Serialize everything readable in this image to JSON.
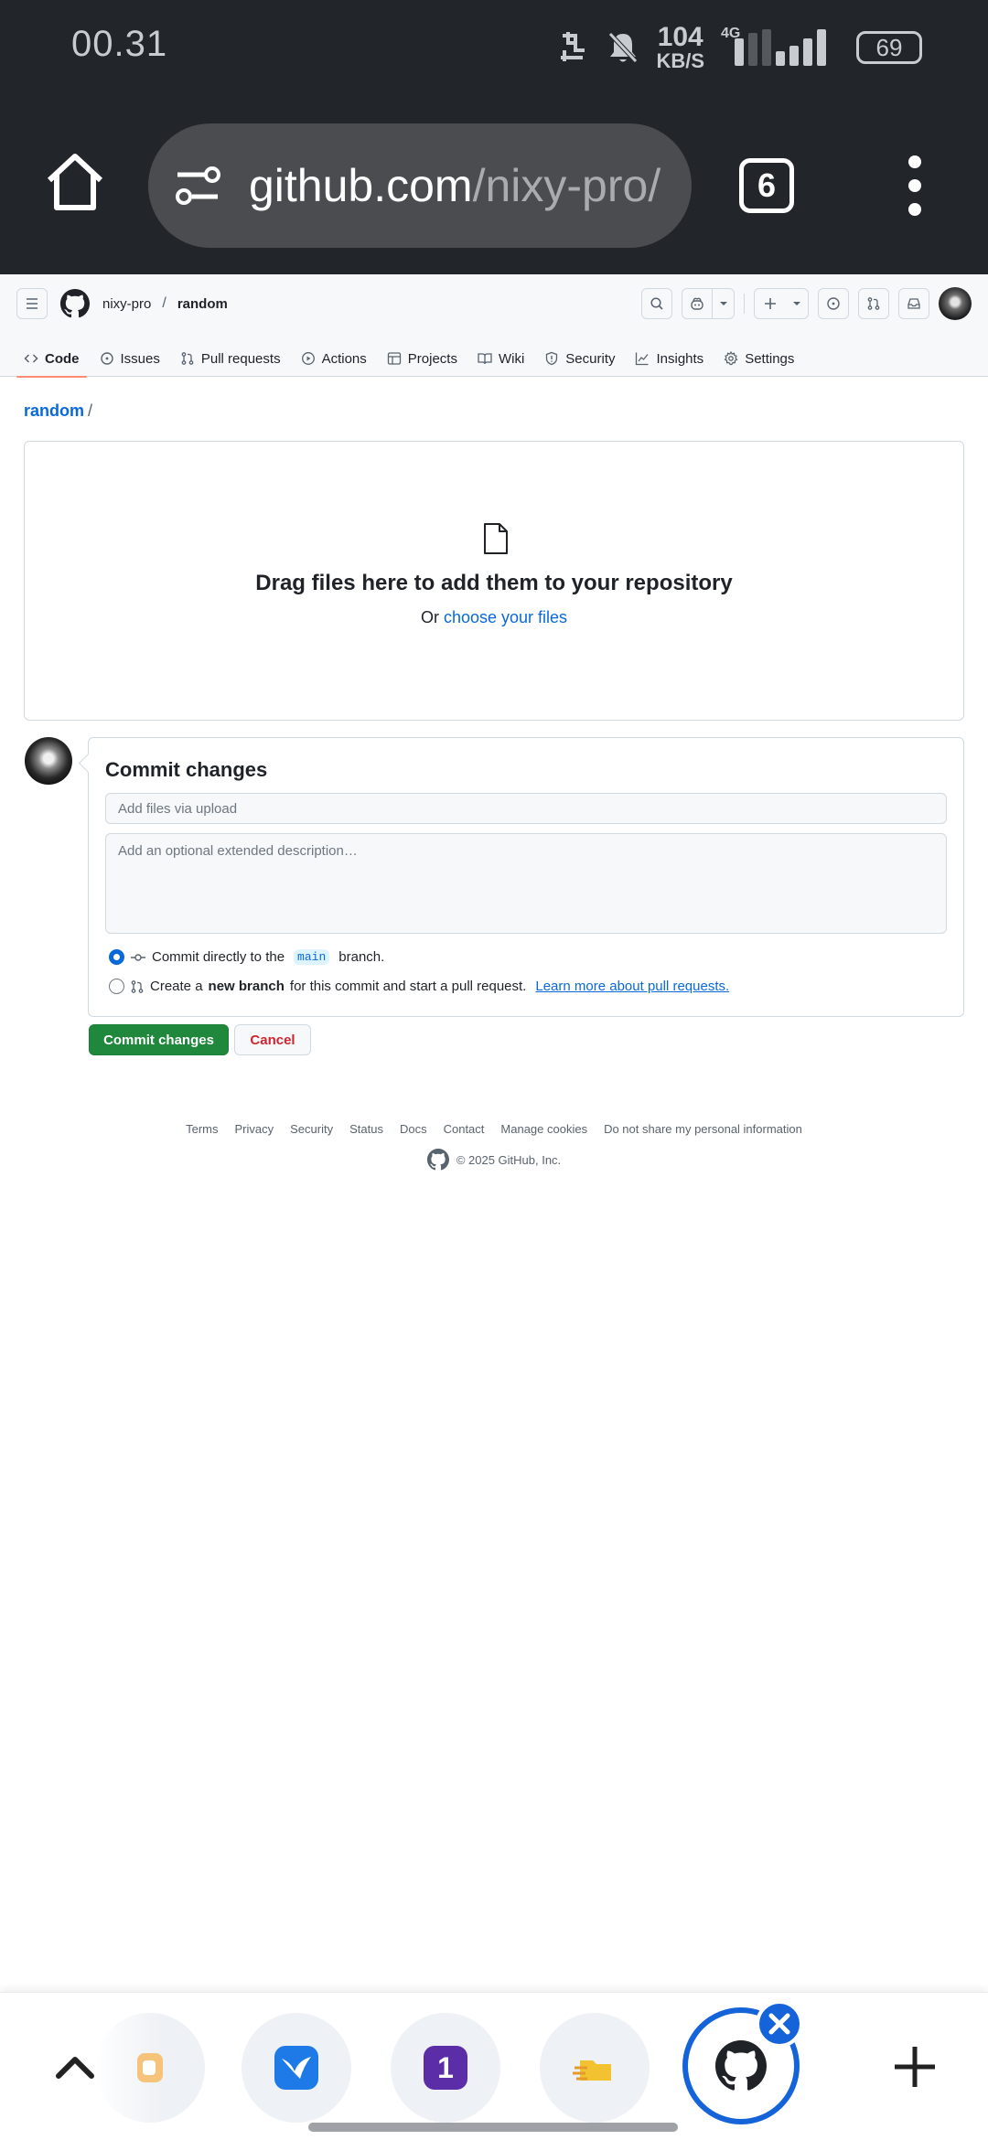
{
  "status_bar": {
    "time": "00.31",
    "net_speed_value": "104",
    "net_speed_unit": "KB/S",
    "network_type": "4G",
    "battery": "69"
  },
  "browser": {
    "url_host": "github.com",
    "url_path": "/nixy-pro/",
    "tab_count": "6"
  },
  "header": {
    "owner": "nixy-pro",
    "separator": "/",
    "repo": "random"
  },
  "repo_nav": {
    "items": [
      {
        "label": "Code",
        "icon": "code-icon",
        "selected": true
      },
      {
        "label": "Issues",
        "icon": "issue-opened-icon"
      },
      {
        "label": "Pull requests",
        "icon": "git-pull-request-icon"
      },
      {
        "label": "Actions",
        "icon": "play-icon"
      },
      {
        "label": "Projects",
        "icon": "table-icon"
      },
      {
        "label": "Wiki",
        "icon": "book-icon"
      },
      {
        "label": "Security",
        "icon": "shield-icon"
      },
      {
        "label": "Insights",
        "icon": "graph-icon"
      },
      {
        "label": "Settings",
        "icon": "gear-icon"
      }
    ]
  },
  "breadcrumb": {
    "repo": "random",
    "slash": "/"
  },
  "dropzone": {
    "title": "Drag files here to add them to your repository",
    "prefix": "Or ",
    "link": "choose your files"
  },
  "commit": {
    "title": "Commit changes",
    "summary_placeholder": "Add files via upload",
    "description_placeholder": "Add an optional extended description…",
    "option_direct_prefix": "Commit directly to the",
    "option_direct_branch": "main",
    "option_direct_suffix": "branch.",
    "option_branch_prefix": "Create a",
    "option_branch_bold": "new branch",
    "option_branch_suffix": "for this commit and start a pull request.",
    "option_branch_link": "Learn more about pull requests.",
    "selected_option": "direct",
    "submit_label": "Commit changes",
    "cancel_label": "Cancel"
  },
  "footer": {
    "links": [
      "Terms",
      "Privacy",
      "Security",
      "Status",
      "Docs",
      "Contact",
      "Manage cookies",
      "Do not share my personal information"
    ],
    "copyright": "© 2025 GitHub, Inc."
  },
  "tab_strip": {
    "tab3_badge": "1"
  },
  "colors": {
    "accent_blue": "#0969da",
    "commit_green": "#1f883d",
    "cancel_red": "#d1242f",
    "nav_underline": "#fd8c73",
    "browser_chrome": "#22262b"
  }
}
